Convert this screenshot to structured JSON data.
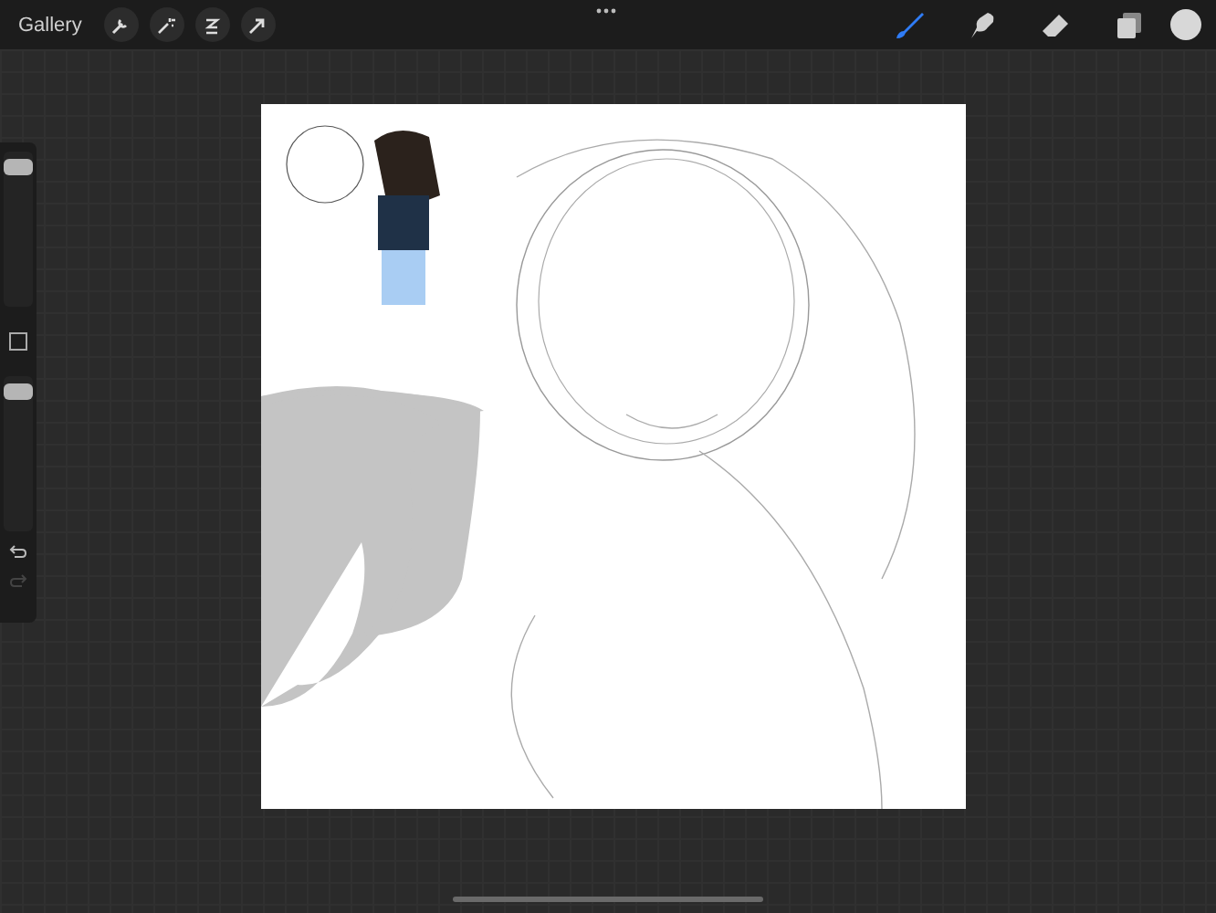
{
  "top_bar": {
    "gallery": "Gallery",
    "actions": [
      {
        "kind": "wrench"
      },
      {
        "kind": "wand"
      },
      {
        "kind": "selection"
      },
      {
        "kind": "arrow"
      }
    ],
    "tools": [
      {
        "kind": "brush",
        "selected": true
      },
      {
        "kind": "smudge",
        "selected": false
      },
      {
        "kind": "eraser",
        "selected": false
      },
      {
        "kind": "layers",
        "selected": false
      }
    ],
    "color": "#d8d8d8"
  },
  "sidebar": {
    "size_slider": {
      "level": 0.95
    },
    "opacity_slider": {
      "level": 0.95
    },
    "undo_disabled": false,
    "redo_disabled": true
  }
}
